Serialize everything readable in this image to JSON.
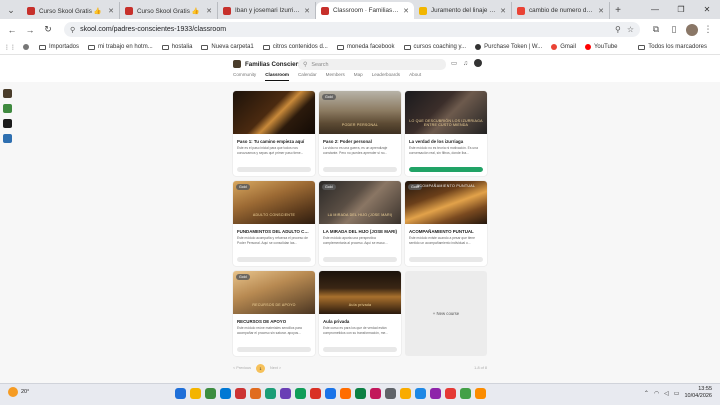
{
  "browser": {
    "tabs": [
      {
        "title": "Curso Skool Gratis 👍",
        "fav_color": "#c7302b",
        "active": false
      },
      {
        "title": "Curso Skool Gratis 👍",
        "fav_color": "#c7302b",
        "active": false
      },
      {
        "title": "Iban y josemari Izurriaga",
        "fav_color": "#c7302b",
        "active": false
      },
      {
        "title": "Classroom · Familias Cons...",
        "fav_color": "#c7302b",
        "active": true
      },
      {
        "title": "Juramento del linaje - Mo...",
        "fav_color": "#f2b600",
        "active": false
      },
      {
        "title": "cambio de numero de telé...",
        "fav_color": "#ea4335",
        "active": false
      }
    ],
    "url": "skool.com/padres-conscientes-1933/classroom",
    "bookmarks": [
      "Importados",
      "mi trabajo en hotm...",
      "hostalia",
      "Nueva carpeta1",
      "citros contenidos d...",
      "moneda facebook",
      "cursos coaching y...",
      "Purchase Token | W...",
      "Gmail",
      "YouTube"
    ],
    "bookmarks_right": "Todos los marcadores"
  },
  "app": {
    "group_name": "Familias Conscientes",
    "search_placeholder": "Search",
    "nav": [
      "Community",
      "Classroom",
      "Calendar",
      "Members",
      "Map",
      "Leaderboards",
      "About"
    ],
    "active_nav": "Classroom"
  },
  "courses": [
    {
      "title": "Paso 1: Tu camino empieza aquí",
      "desc": "Este es el paso inicial para que todos nos conozcamos y sepas qué primer paso tiene...",
      "progress": 0,
      "badge": "",
      "thumb_caption": "",
      "thumb_top": "",
      "bg": "linear-gradient(135deg,#1c120a 0%,#4b2a10 45%,#c98a3a 55%,#2b1a0c 70%,#120a05 100%)"
    },
    {
      "title": "Paso 2: Poder personal",
      "desc": "La vida no es una guerra, es un aprendizaje constante. Pero no puedes aprender si no...",
      "progress": 0,
      "badge": "Gold",
      "thumb_caption": "PODER PERSONAL",
      "thumb_top": "",
      "bg": "linear-gradient(180deg,#b7b3a8 0%,#8d7c63 45%,#5d4b34 75%,#3d3021 100%)"
    },
    {
      "title": "La verdad de los izurriaga",
      "desc": "Este módulo no es teoría ni motivación. Es una conversación real, sin filtros, donde Iba...",
      "progress": 100,
      "badge": "",
      "thumb_caption": "LO QUE DESCUBRIÓN LOS IZURRIAGA ENTRE CUSTO MIENDA",
      "thumb_top": "",
      "bg": "linear-gradient(135deg,#1a1a1d 0%,#3b2e2a 40%,#6d5a4d 55%,#222 100%)"
    },
    {
      "title": "FUNDAMENTOS DEL ADULTO CO...",
      "desc": "Este módulo acompaña y refuerza el proceso de Poder Personal. Aquí se consolidan las...",
      "progress": 0,
      "badge": "Gold",
      "thumb_caption": "ADULTO CONSCIENTE",
      "thumb_top": "",
      "bg": "linear-gradient(160deg,#d8a860 0%,#9c6a34 40%,#5b3a1c 75%,#2e1d10 100%)"
    },
    {
      "title": "LA MIRADA DEL HIJO (JOSE MARI)",
      "desc": "Este módulo aporta una perspectiva complementaria al proceso. Aquí se escuc...",
      "progress": 0,
      "badge": "Gold",
      "thumb_caption": "LA MIRADA DEL HIJO (JOSE MARI)",
      "thumb_top": "",
      "bg": "linear-gradient(135deg,#2c2a28 0%,#5a4e44 40%,#8a7664 55%,#3a322c 100%)"
    },
    {
      "title": "ACOMPAÑAMIENTO PUNTUAL",
      "desc": "Este módulo existe cuando a pesar que tiene sentido un acompañamiento individual o...",
      "progress": 0,
      "badge": "Gold",
      "thumb_caption": "",
      "thumb_top": "ACOMPAÑAMIENTO PUNTUAL",
      "bg": "linear-gradient(160deg,#1f140c 0%,#6b3f1a 35%,#e2a24a 55%,#7a4a20 75%,#24170d 100%)"
    },
    {
      "title": "RECURSOS DE APOYO",
      "desc": "Este módulo reúne materiales sencillos para acompañar el proceso sin saturar. apoyos...",
      "progress": 0,
      "badge": "Gold",
      "thumb_caption": "RECURSOS DE APOYO",
      "thumb_top": "",
      "bg": "linear-gradient(160deg,#e8c48c 0%,#b88a52 40%,#7a5a36 75%,#4a3522 100%)"
    },
    {
      "title": "Aula privada",
      "desc": "Este curso es para los que de verdad están comprometidos con su transformación, me...",
      "progress": 0,
      "badge": "",
      "thumb_caption": "Aula privada",
      "thumb_top": "",
      "bg": "linear-gradient(180deg,#1a120b 0%,#3a2614 40%,#a8702d 60%,#2a1a0d 100%)"
    }
  ],
  "new_course_label": "+  New course",
  "pager": {
    "prev": "< Previous",
    "page": "1",
    "next": "Next >",
    "count": "1-8 of 8"
  },
  "taskbar": {
    "temp": "20°",
    "time": "13:55",
    "date": "10/04/2026",
    "apps": [
      "#1f6fd8",
      "#f4b400",
      "#3c8d40",
      "#0078d4",
      "#c33",
      "#e06c1f",
      "#1b9e77",
      "#6a3fb5",
      "#0f9d58",
      "#d93025",
      "#1a73e8",
      "#ff6d00",
      "#0b8043",
      "#c2185b",
      "#5f6368",
      "#f9ab00",
      "#1e88e5",
      "#8e24aa",
      "#e53935",
      "#43a047",
      "#fb8c00"
    ]
  }
}
